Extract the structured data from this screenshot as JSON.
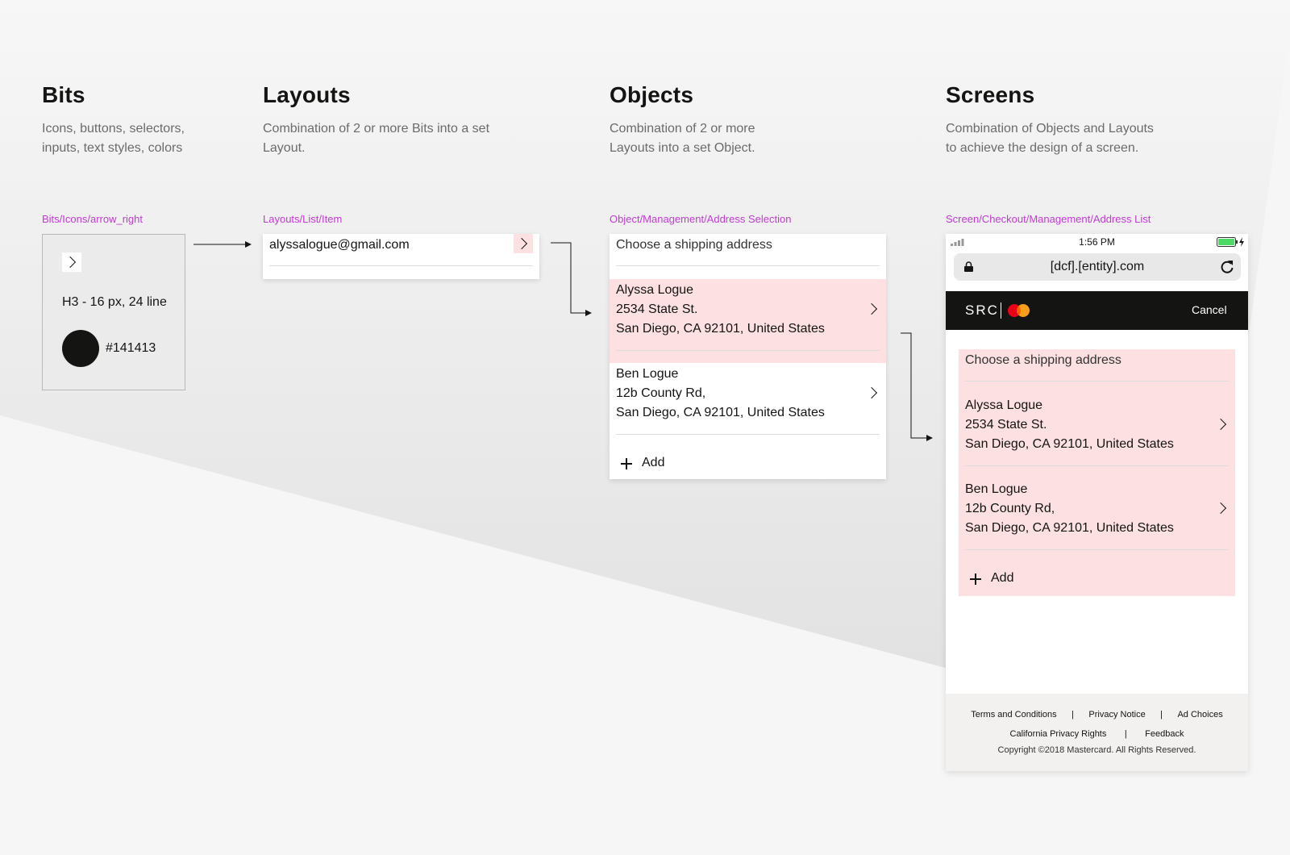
{
  "colors": {
    "accent_pink": "#fde0e1",
    "tag_magenta": "#c23ad6",
    "swatch_black": "#141413",
    "header_black": "#141413",
    "battery_green": "#4cd964"
  },
  "columns": {
    "bits": {
      "title": "Bits",
      "desc1": "Icons, buttons, selectors,",
      "desc2": "inputs, text styles, colors",
      "tag": "Bits/Icons/arrow_right"
    },
    "layouts": {
      "title": "Layouts",
      "desc1": "Combination of 2 or more Bits into a set",
      "desc2": "Layout.",
      "tag": "Layouts/List/Item"
    },
    "objects": {
      "title": "Objects",
      "desc1": "Combination of 2 or more",
      "desc2": "Layouts into a set Object.",
      "tag": "Object/Management/Address Selection"
    },
    "screens": {
      "title": "Screens",
      "desc1": "Combination of Objects and Layouts",
      "desc2": "to achieve the design of a screen.",
      "tag": "Screen/Checkout/Management/Address List"
    }
  },
  "bits_card": {
    "icon": "chevron-right-icon",
    "text_style": "H3 - 16 px, 24 line",
    "swatch_label": "#141413"
  },
  "layout_card": {
    "email": "alyssalogue@gmail.com"
  },
  "address_object": {
    "heading": "Choose a shipping address",
    "addresses": [
      {
        "name": "Alyssa Logue",
        "line1": "2534 State St.",
        "line2": "San Diego, CA 92101, United States"
      },
      {
        "name": "Ben Logue",
        "line1": "12b County Rd,",
        "line2": "San Diego, CA 92101, United States"
      }
    ],
    "add_label": "Add"
  },
  "phone": {
    "time": "1:56 PM",
    "url": "[dcf].[entity].com",
    "brand": "SRC",
    "cancel": "Cancel",
    "footer": {
      "terms": "Terms and Conditions",
      "privacy": "Privacy Notice",
      "ad_choices": "Ad Choices",
      "ca_privacy": "California Privacy Rights",
      "feedback": "Feedback",
      "copyright": "Copyright ©2018 Mastercard. All Rights Reserved.",
      "separator": "|"
    }
  }
}
